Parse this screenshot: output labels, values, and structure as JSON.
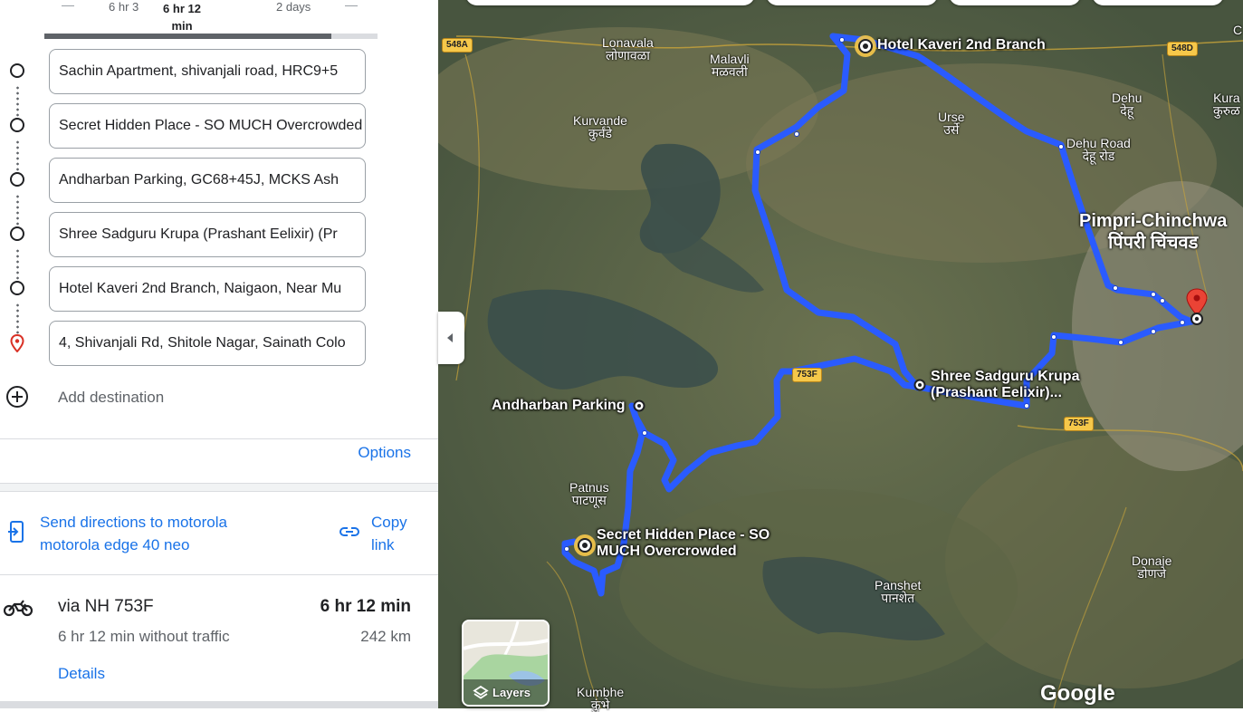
{
  "timeline": {
    "left_label": "6 hr 3",
    "active_label_line1": "6 hr 12",
    "active_label_line2": "min",
    "right_label": "2 days"
  },
  "stops": [
    {
      "value": "Sachin Apartment, shivanjali road, HRC9+5",
      "icon": "circle-icon"
    },
    {
      "value": "Secret Hidden Place - SO MUCH Overcrowded",
      "icon": "circle-icon"
    },
    {
      "value": "Andharban Parking, GC68+45J, MCKS Ash",
      "icon": "circle-icon"
    },
    {
      "value": "Shree Sadguru Krupa (Prashant Eelixir) (Pr",
      "icon": "circle-icon"
    },
    {
      "value": "Hotel Kaveri 2nd Branch, Naigaon, Near Mu",
      "icon": "circle-icon"
    },
    {
      "value": "4, Shivanjali Rd, Shitole Nagar, Sainath Colo",
      "icon": "red-pin-icon"
    }
  ],
  "add_destination": "Add destination",
  "options_label": "Options",
  "send": {
    "line1": "Send directions to motorola",
    "line2": "motorola edge 40 neo"
  },
  "copy": {
    "line1": "Copy",
    "line2": "link"
  },
  "route": {
    "via": "via NH 753F",
    "time": "6 hr 12 min",
    "subtitle": "6 hr 12 min without traffic",
    "distance": "242 km",
    "details_label": "Details"
  },
  "map": {
    "places": {
      "lonavala": {
        "en": "Lonavala",
        "mr": "लोणावळा"
      },
      "malavli": {
        "en": "Malavli",
        "mr": "मळवली"
      },
      "kurvande": {
        "en": "Kurvande",
        "mr": "कुर्वंडे"
      },
      "urse": {
        "en": "Urse",
        "mr": "उर्से"
      },
      "dehu": {
        "en": "Dehu",
        "mr": "देहू"
      },
      "dehu_road": {
        "en": "Dehu Road",
        "mr": "देहू रोड"
      },
      "kura": {
        "en": "Kura",
        "mr": "कुरुळ"
      },
      "pimpri": {
        "en": "Pimpri-Chinchwa",
        "mr": "पिंपरी चिंचवड"
      },
      "patnus": {
        "en": "Patnus",
        "mr": "पाटणूस"
      },
      "panshet": {
        "en": "Panshet",
        "mr": "पानशेत"
      },
      "donaje": {
        "en": "Donaje",
        "mr": "डोणजे"
      },
      "kumbhe": {
        "en": "Kumbhe",
        "mr": "कुंभे"
      }
    },
    "stop_labels": {
      "hotel_kaveri": "Hotel Kaveri 2nd Branch",
      "andharban": "Andharban Parking",
      "sadguru_line1": "Shree Sadguru Krupa",
      "sadguru_line2": "(Prashant Eelixir)...",
      "secret_line1": "Secret Hidden Place - SO",
      "secret_line2": "MUCH Overcrowded"
    },
    "shields": {
      "s548a": "548A",
      "s548d": "548D",
      "s753f_a": "753F",
      "s753f_b": "753F"
    },
    "corner_letter": "C",
    "layers_label": "Layers",
    "google": "Google",
    "route_color": "#2a5bff"
  }
}
